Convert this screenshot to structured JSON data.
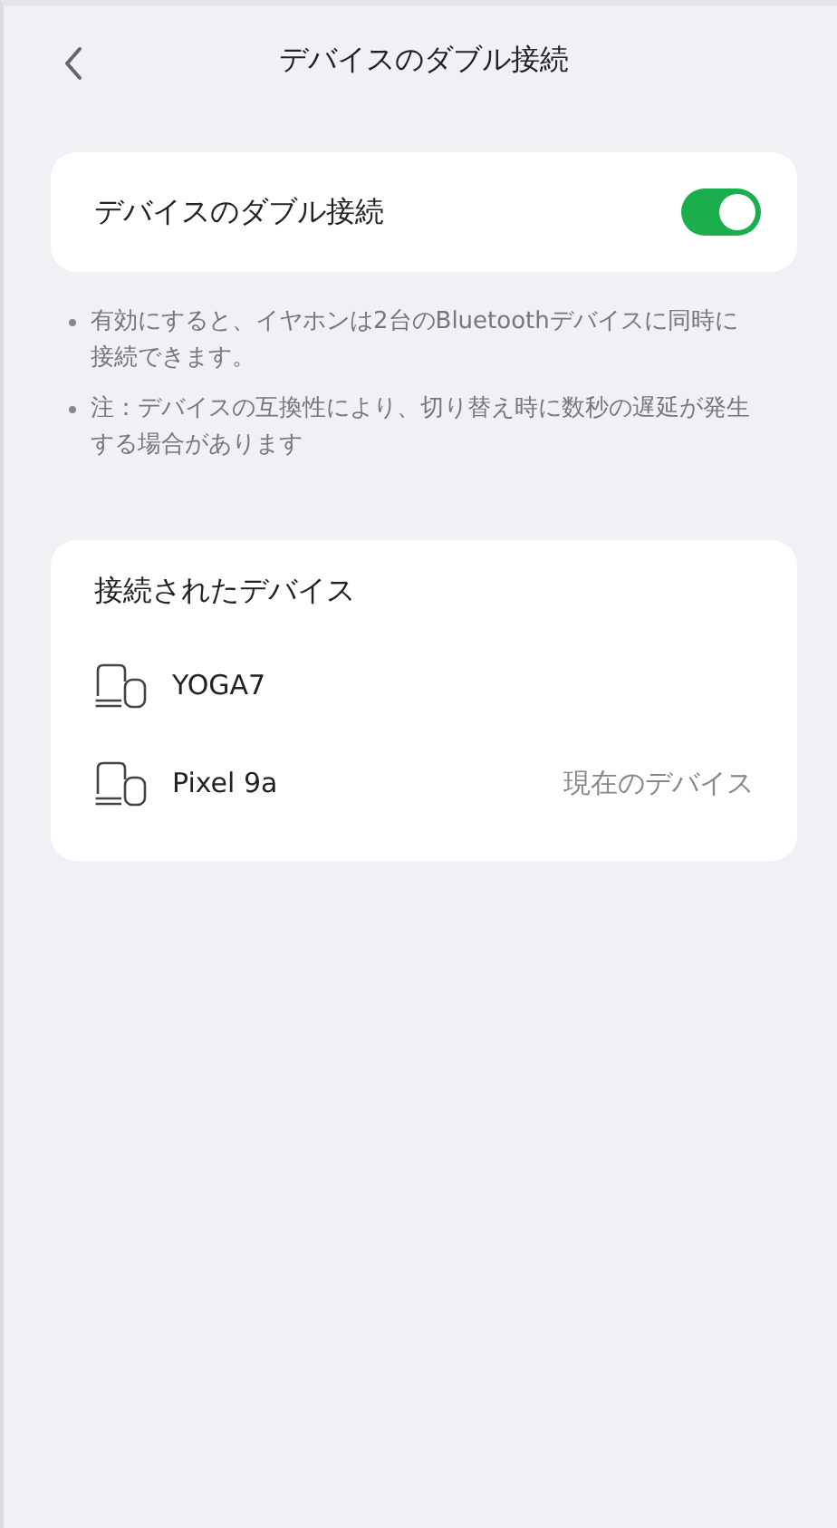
{
  "header": {
    "title": "デバイスのダブル接続"
  },
  "toggle": {
    "label": "デバイスのダブル接続",
    "on": true
  },
  "notes": [
    "有効にすると、イヤホンは2台のBluetoothデバイスに同時に接続できます。",
    "注：デバイスの互換性により、切り替え時に数秒の遅延が発生する場合があります"
  ],
  "devices": {
    "title": "接続されたデバイス",
    "items": [
      {
        "name": "YOGA7"
      },
      {
        "name": "Pixel 9a",
        "status": "現在のデバイス"
      }
    ]
  }
}
